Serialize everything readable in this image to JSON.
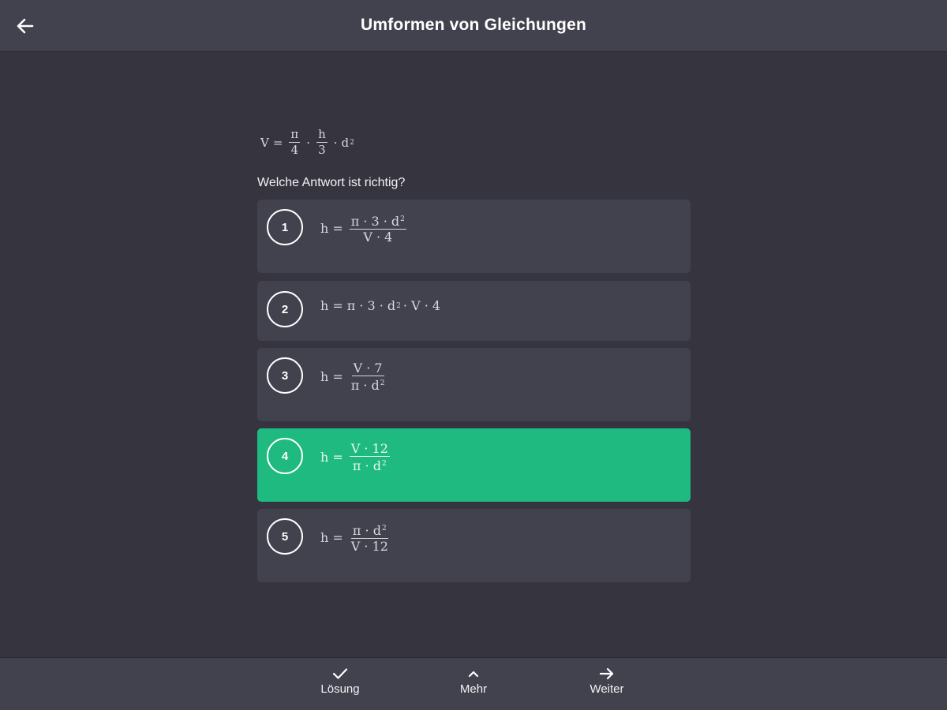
{
  "header": {
    "title": "Umformen von Gleichungen",
    "back_icon": "arrow-left-icon"
  },
  "task": {
    "formula": {
      "lhs": "V",
      "eq": "=",
      "f1_num": "π",
      "f1_den": "4",
      "dot1": "·",
      "f2_num": "h",
      "f2_den": "3",
      "dot2": "·",
      "base": "d",
      "exp": "2"
    },
    "question": "Welche Antwort ist richtig?"
  },
  "options": [
    {
      "number": "1",
      "lhs": "h",
      "eq": "=",
      "num_a": "π · 3 · d",
      "num_exp": "2",
      "den": "V · 4"
    },
    {
      "number": "2",
      "lhs": "h",
      "eq": "=",
      "expr_a": "π · 3 · d",
      "expr_exp": "2",
      "expr_b": "· V · 4"
    },
    {
      "number": "3",
      "lhs": "h",
      "eq": "=",
      "num": "V · 7",
      "den_a": "π · d",
      "den_exp": "2"
    },
    {
      "number": "4",
      "lhs": "h",
      "eq": "=",
      "num": "V · 12",
      "den_a": "π · d",
      "den_exp": "2",
      "state": "correct"
    },
    {
      "number": "5",
      "lhs": "h",
      "eq": "=",
      "num_a": "π · d",
      "num_exp": "2",
      "den": "V · 12"
    }
  ],
  "footer": {
    "solution": {
      "label": "Lösung",
      "icon": "check-icon"
    },
    "more": {
      "label": "Mehr",
      "icon": "chevron-up-icon"
    },
    "next": {
      "label": "Weiter",
      "icon": "arrow-right-icon"
    }
  },
  "colors": {
    "background": "#35343f",
    "bar": "#42414e",
    "card": "#42414e",
    "correct": "#1fba80",
    "text": "#ffffff"
  }
}
